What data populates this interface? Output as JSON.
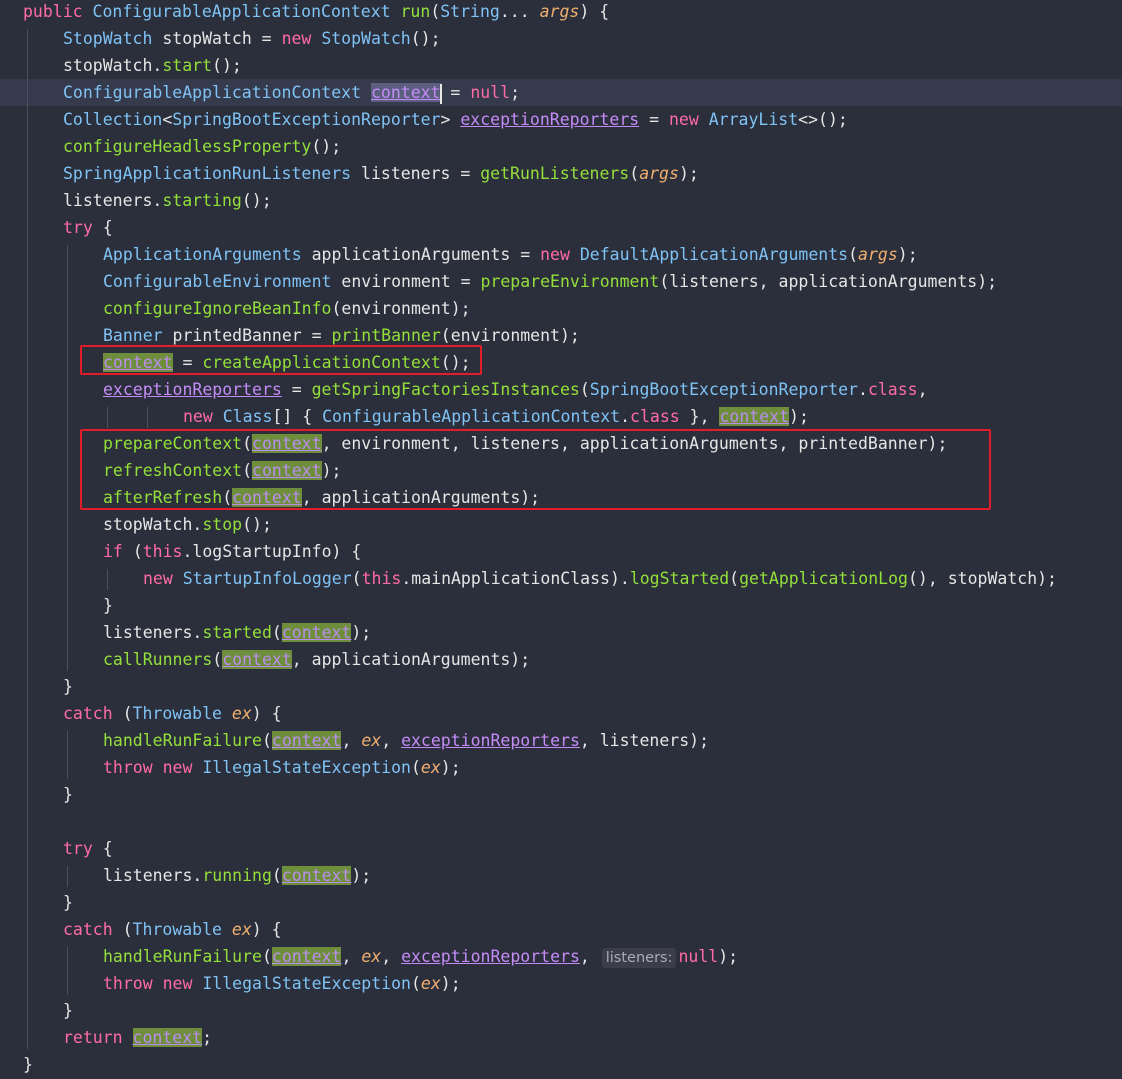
{
  "editor": {
    "colors": {
      "background": "#2b2e3b",
      "current_line": "#353a4c",
      "keyword": "#ff6ba5",
      "type": "#7fc3f5",
      "method": "#94e03a",
      "parameter": "#f0b070",
      "field": "#c58cf7",
      "usage_highlight": "#6f8e3c",
      "annotation_box": "#e11d2a"
    },
    "lines": [
      {
        "indent": 0,
        "tokens": [
          [
            "kw",
            "public "
          ],
          [
            "ty",
            "ConfigurableApplicationContext "
          ],
          [
            "fn",
            "run"
          ],
          [
            "tx",
            "("
          ],
          [
            "ty",
            "String"
          ],
          [
            "tx",
            "... "
          ],
          [
            "par",
            "args"
          ],
          [
            "tx",
            ") {"
          ]
        ]
      },
      {
        "indent": 1,
        "tokens": [
          [
            "ty",
            "StopWatch "
          ],
          [
            "tx",
            "stopWatch = "
          ],
          [
            "kw",
            "new "
          ],
          [
            "ty",
            "StopWatch"
          ],
          [
            "tx",
            "();"
          ]
        ]
      },
      {
        "indent": 1,
        "tokens": [
          [
            "tx",
            "stopWatch."
          ],
          [
            "fn",
            "start"
          ],
          [
            "tx",
            "();"
          ]
        ]
      },
      {
        "indent": 1,
        "current": true,
        "tokens": [
          [
            "ty",
            "ConfigurableApplicationContext "
          ],
          [
            "hl-sel",
            "context"
          ],
          [
            "caret",
            ""
          ],
          [
            "tx",
            " = "
          ],
          [
            "kw",
            "null"
          ],
          [
            "tx",
            ";"
          ]
        ]
      },
      {
        "indent": 1,
        "tokens": [
          [
            "ty",
            "Collection"
          ],
          [
            "tx",
            "<"
          ],
          [
            "ty",
            "SpringBootExceptionReporter"
          ],
          [
            "tx",
            "> "
          ],
          [
            "fld",
            "exceptionReporters"
          ],
          [
            "tx",
            " = "
          ],
          [
            "kw",
            "new "
          ],
          [
            "ty",
            "ArrayList"
          ],
          [
            "tx",
            "<>();"
          ]
        ]
      },
      {
        "indent": 1,
        "tokens": [
          [
            "fn",
            "configureHeadlessProperty"
          ],
          [
            "tx",
            "();"
          ]
        ]
      },
      {
        "indent": 1,
        "tokens": [
          [
            "ty",
            "SpringApplicationRunListeners "
          ],
          [
            "tx",
            "listeners = "
          ],
          [
            "fn",
            "getRunListeners"
          ],
          [
            "tx",
            "("
          ],
          [
            "par",
            "args"
          ],
          [
            "tx",
            ");"
          ]
        ]
      },
      {
        "indent": 1,
        "tokens": [
          [
            "tx",
            "listeners."
          ],
          [
            "fn",
            "starting"
          ],
          [
            "tx",
            "();"
          ]
        ]
      },
      {
        "indent": 1,
        "tokens": [
          [
            "kw",
            "try "
          ],
          [
            "tx",
            "{"
          ]
        ]
      },
      {
        "indent": 2,
        "tokens": [
          [
            "ty",
            "ApplicationArguments "
          ],
          [
            "tx",
            "applicationArguments = "
          ],
          [
            "kw",
            "new "
          ],
          [
            "ty",
            "DefaultApplicationArguments"
          ],
          [
            "tx",
            "("
          ],
          [
            "par",
            "args"
          ],
          [
            "tx",
            ");"
          ]
        ]
      },
      {
        "indent": 2,
        "tokens": [
          [
            "ty",
            "ConfigurableEnvironment "
          ],
          [
            "tx",
            "environment = "
          ],
          [
            "fn",
            "prepareEnvironment"
          ],
          [
            "tx",
            "(listeners, applicationArguments);"
          ]
        ]
      },
      {
        "indent": 2,
        "tokens": [
          [
            "fn",
            "configureIgnoreBeanInfo"
          ],
          [
            "tx",
            "(environment);"
          ]
        ]
      },
      {
        "indent": 2,
        "tokens": [
          [
            "ty",
            "Banner "
          ],
          [
            "tx",
            "printedBanner = "
          ],
          [
            "fn",
            "printBanner"
          ],
          [
            "tx",
            "(environment);"
          ]
        ]
      },
      {
        "indent": 2,
        "tokens": [
          [
            "hl",
            "context"
          ],
          [
            "tx",
            " = "
          ],
          [
            "fn",
            "createApplicationContext"
          ],
          [
            "tx",
            "();"
          ]
        ]
      },
      {
        "indent": 2,
        "tokens": [
          [
            "fld",
            "exceptionReporters"
          ],
          [
            "tx",
            " = "
          ],
          [
            "fn",
            "getSpringFactoriesInstances"
          ],
          [
            "tx",
            "("
          ],
          [
            "ty",
            "SpringBootExceptionReporter"
          ],
          [
            "tx",
            "."
          ],
          [
            "kw",
            "class"
          ],
          [
            "tx",
            ","
          ]
        ]
      },
      {
        "indent": 4,
        "tokens": [
          [
            "kw",
            "new "
          ],
          [
            "ty",
            "Class"
          ],
          [
            "tx",
            "[] { "
          ],
          [
            "ty",
            "ConfigurableApplicationContext"
          ],
          [
            "tx",
            "."
          ],
          [
            "kw",
            "class"
          ],
          [
            "tx",
            " }, "
          ],
          [
            "hl",
            "context"
          ],
          [
            "tx",
            ");"
          ]
        ]
      },
      {
        "indent": 2,
        "tokens": [
          [
            "fn",
            "prepareContext"
          ],
          [
            "tx",
            "("
          ],
          [
            "hl",
            "context"
          ],
          [
            "tx",
            ", environment, listeners, applicationArguments, printedBanner);"
          ]
        ]
      },
      {
        "indent": 2,
        "tokens": [
          [
            "fn",
            "refreshContext"
          ],
          [
            "tx",
            "("
          ],
          [
            "hl",
            "context"
          ],
          [
            "tx",
            ");"
          ]
        ]
      },
      {
        "indent": 2,
        "tokens": [
          [
            "fn",
            "afterRefresh"
          ],
          [
            "tx",
            "("
          ],
          [
            "hl",
            "context"
          ],
          [
            "tx",
            ", applicationArguments);"
          ]
        ]
      },
      {
        "indent": 2,
        "tokens": [
          [
            "tx",
            "stopWatch."
          ],
          [
            "fn",
            "stop"
          ],
          [
            "tx",
            "();"
          ]
        ]
      },
      {
        "indent": 2,
        "tokens": [
          [
            "kw",
            "if "
          ],
          [
            "tx",
            "("
          ],
          [
            "kw",
            "this"
          ],
          [
            "tx",
            ".logStartupInfo) {"
          ]
        ]
      },
      {
        "indent": 3,
        "tokens": [
          [
            "kw",
            "new "
          ],
          [
            "ty",
            "StartupInfoLogger"
          ],
          [
            "tx",
            "("
          ],
          [
            "kw",
            "this"
          ],
          [
            "tx",
            ".mainApplicationClass)."
          ],
          [
            "fn",
            "logStarted"
          ],
          [
            "tx",
            "("
          ],
          [
            "fn",
            "getApplicationLog"
          ],
          [
            "tx",
            "(), stopWatch);"
          ]
        ]
      },
      {
        "indent": 2,
        "tokens": [
          [
            "tx",
            "}"
          ]
        ]
      },
      {
        "indent": 2,
        "tokens": [
          [
            "tx",
            "listeners."
          ],
          [
            "fn",
            "started"
          ],
          [
            "tx",
            "("
          ],
          [
            "hl",
            "context"
          ],
          [
            "tx",
            ");"
          ]
        ]
      },
      {
        "indent": 2,
        "tokens": [
          [
            "fn",
            "callRunners"
          ],
          [
            "tx",
            "("
          ],
          [
            "hl",
            "context"
          ],
          [
            "tx",
            ", applicationArguments);"
          ]
        ]
      },
      {
        "indent": 1,
        "tokens": [
          [
            "tx",
            "}"
          ]
        ]
      },
      {
        "indent": 1,
        "tokens": [
          [
            "kw",
            "catch "
          ],
          [
            "tx",
            "("
          ],
          [
            "ty",
            "Throwable "
          ],
          [
            "par",
            "ex"
          ],
          [
            "tx",
            ") {"
          ]
        ]
      },
      {
        "indent": 2,
        "tokens": [
          [
            "fn",
            "handleRunFailure"
          ],
          [
            "tx",
            "("
          ],
          [
            "hl",
            "context"
          ],
          [
            "tx",
            ", "
          ],
          [
            "par",
            "ex"
          ],
          [
            "tx",
            ", "
          ],
          [
            "fld",
            "exceptionReporters"
          ],
          [
            "tx",
            ", listeners);"
          ]
        ]
      },
      {
        "indent": 2,
        "tokens": [
          [
            "kw",
            "throw new "
          ],
          [
            "ty",
            "IllegalStateException"
          ],
          [
            "tx",
            "("
          ],
          [
            "par",
            "ex"
          ],
          [
            "tx",
            ");"
          ]
        ]
      },
      {
        "indent": 1,
        "tokens": [
          [
            "tx",
            "}"
          ]
        ]
      },
      {
        "indent": 0,
        "tokens": []
      },
      {
        "indent": 1,
        "tokens": [
          [
            "kw",
            "try "
          ],
          [
            "tx",
            "{"
          ]
        ]
      },
      {
        "indent": 2,
        "tokens": [
          [
            "tx",
            "listeners."
          ],
          [
            "fn",
            "running"
          ],
          [
            "tx",
            "("
          ],
          [
            "hl",
            "context"
          ],
          [
            "tx",
            ");"
          ]
        ]
      },
      {
        "indent": 1,
        "tokens": [
          [
            "tx",
            "}"
          ]
        ]
      },
      {
        "indent": 1,
        "tokens": [
          [
            "kw",
            "catch "
          ],
          [
            "tx",
            "("
          ],
          [
            "ty",
            "Throwable "
          ],
          [
            "par",
            "ex"
          ],
          [
            "tx",
            ") {"
          ]
        ]
      },
      {
        "indent": 2,
        "tokens": [
          [
            "fn",
            "handleRunFailure"
          ],
          [
            "tx",
            "("
          ],
          [
            "hl",
            "context"
          ],
          [
            "tx",
            ", "
          ],
          [
            "par",
            "ex"
          ],
          [
            "tx",
            ", "
          ],
          [
            "fld",
            "exceptionReporters"
          ],
          [
            "tx",
            ", "
          ],
          [
            "hint",
            "listeners:"
          ],
          [
            "kw",
            "null"
          ],
          [
            "tx",
            ");"
          ]
        ]
      },
      {
        "indent": 2,
        "tokens": [
          [
            "kw",
            "throw new "
          ],
          [
            "ty",
            "IllegalStateException"
          ],
          [
            "tx",
            "("
          ],
          [
            "par",
            "ex"
          ],
          [
            "tx",
            ");"
          ]
        ]
      },
      {
        "indent": 1,
        "tokens": [
          [
            "tx",
            "}"
          ]
        ]
      },
      {
        "indent": 1,
        "tokens": [
          [
            "kw",
            "return "
          ],
          [
            "hl",
            "context"
          ],
          [
            "tx",
            ";"
          ]
        ]
      },
      {
        "indent": 0,
        "tokens": [
          [
            "tx",
            "}"
          ]
        ]
      }
    ]
  }
}
